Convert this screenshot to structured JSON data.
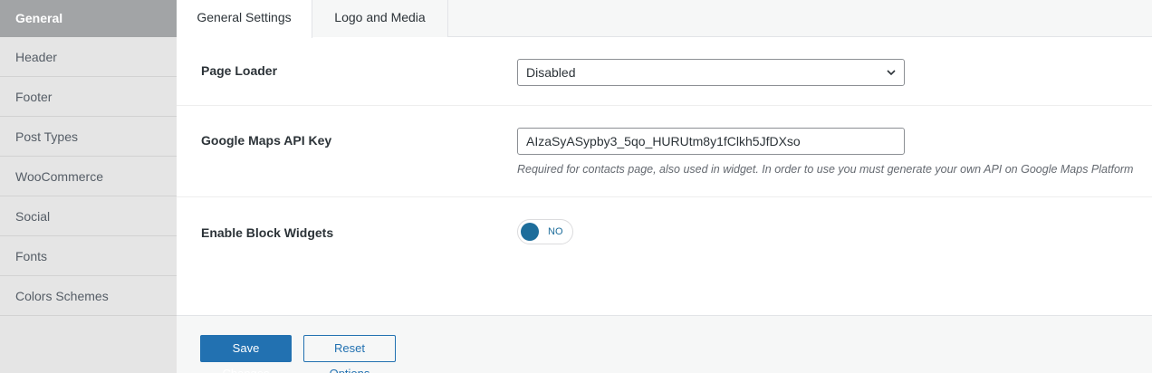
{
  "sidebar": {
    "items": [
      {
        "label": "General",
        "active": true
      },
      {
        "label": "Header"
      },
      {
        "label": "Footer"
      },
      {
        "label": "Post Types"
      },
      {
        "label": "WooCommerce"
      },
      {
        "label": "Social"
      },
      {
        "label": "Fonts"
      },
      {
        "label": "Colors Schemes"
      }
    ]
  },
  "tabs": [
    {
      "label": "General Settings",
      "active": true
    },
    {
      "label": "Logo and Media"
    }
  ],
  "settings": {
    "page_loader": {
      "label": "Page Loader",
      "value": "Disabled"
    },
    "google_maps": {
      "label": "Google Maps API Key",
      "value": "AIzaSyASypby3_5qo_HURUtm8y1fClkh5JfDXso",
      "help": "Required for contacts page, also used in widget. In order to use you must generate your own API on Google Maps Platform"
    },
    "block_widgets": {
      "label": "Enable Block Widgets",
      "toggle_text": "NO",
      "enabled": false
    }
  },
  "actions": {
    "save_label": "Save Changes",
    "reset_label": "Reset Options"
  },
  "colors": {
    "accent": "#2271b1",
    "toggle": "#1d6d9b",
    "sidebar_active": "#a2a4a6"
  }
}
